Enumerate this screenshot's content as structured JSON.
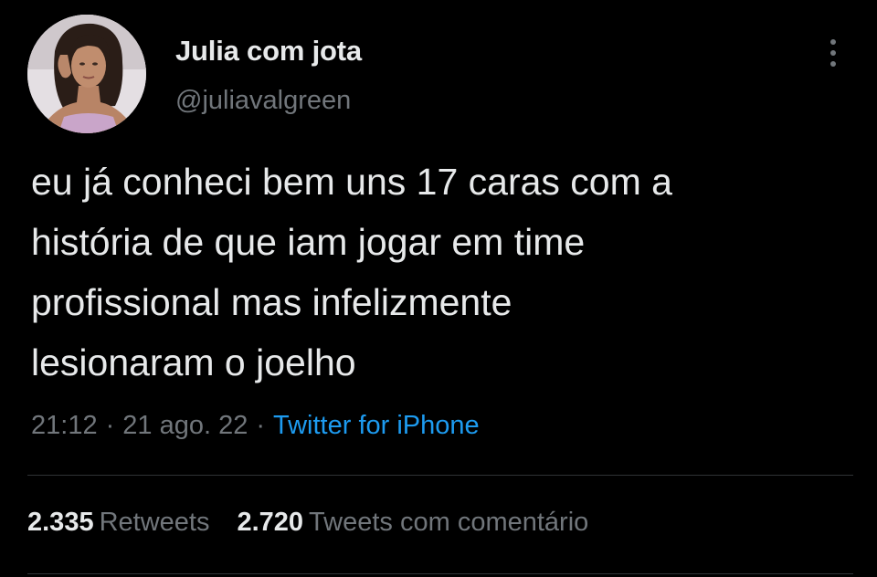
{
  "tweet": {
    "author": {
      "display_name": "Julia com jota",
      "handle": "@juliavalgreen",
      "avatar_icon": "profile-photo"
    },
    "more_icon": "vertical-ellipsis-icon",
    "text_lines": [
      "eu já conheci bem uns 17 caras com a",
      "história de que iam jogar em time",
      "profissional mas infelizmente",
      "lesionaram o joelho"
    ],
    "meta": {
      "time": "21:12",
      "separator": "·",
      "date": "21 ago. 22",
      "source": "Twitter for iPhone"
    },
    "stats": {
      "retweets_count": "2.335",
      "retweets_label": "Retweets",
      "quotes_count": "2.720",
      "quotes_label": "Tweets com comentário"
    }
  },
  "colors": {
    "background": "#000000",
    "primary_text": "#e7e9ea",
    "secondary_text": "#71767b",
    "link": "#1d9bf0",
    "divider": "#2f3336"
  }
}
